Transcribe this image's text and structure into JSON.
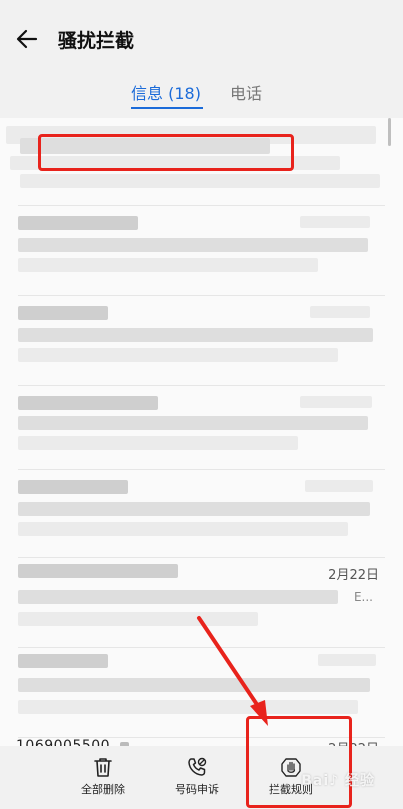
{
  "header": {
    "title": "骚扰拦截",
    "back_icon": "arrow-left-icon"
  },
  "tabs": {
    "messages_label": "信息",
    "messages_count": "(18)",
    "calls_label": "电话",
    "accent_color": "#1b6bd9"
  },
  "list": {
    "items": [
      {
        "date": ""
      },
      {
        "date": ""
      },
      {
        "date": ""
      },
      {
        "date": ""
      },
      {
        "date": ""
      },
      {
        "date": "2月22日",
        "ellipsis": "E..."
      },
      {
        "date": ""
      },
      {
        "sender": "1069005500",
        "date": "2月22日"
      }
    ]
  },
  "toolbar": {
    "delete_all_label": "全部删除",
    "delete_icon": "trash-icon",
    "appeal_label": "号码申诉",
    "appeal_icon": "phone-appeal-icon",
    "rules_label": "拦截规则",
    "rules_icon": "hand-stop-icon"
  },
  "annotation": {
    "color": "#e8231c"
  }
}
